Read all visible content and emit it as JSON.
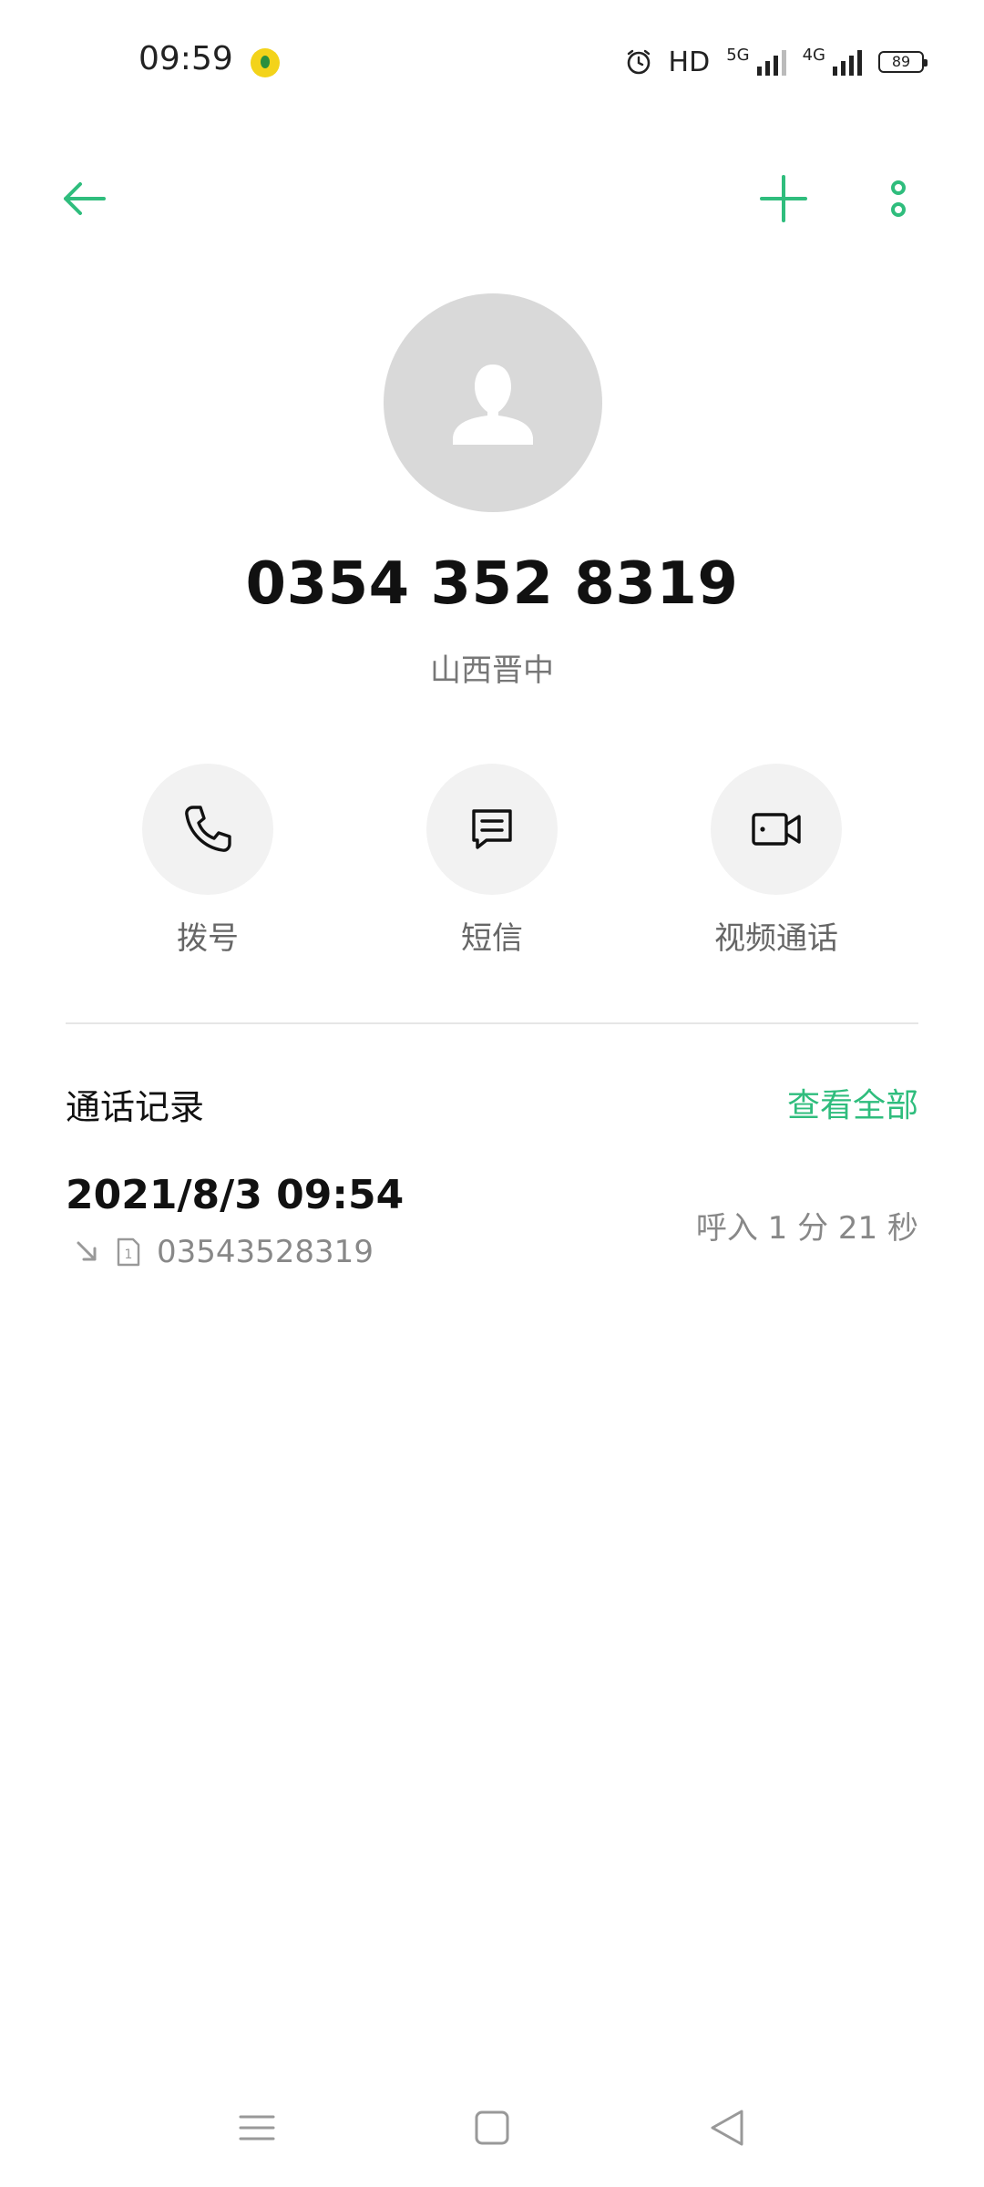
{
  "status_bar": {
    "time": "09:59",
    "hd": "HD",
    "network_5g": "5G",
    "network_4g": "4G",
    "battery": "89",
    "icons": [
      "app-notification-icon",
      "alarm-icon",
      "signal-icon",
      "battery-icon"
    ]
  },
  "toolbar": {
    "icons": [
      "back-arrow-icon",
      "add-icon",
      "more-icon"
    ],
    "accent_color": "#2fbd7d"
  },
  "contact": {
    "phone_number": "0354 352 8319",
    "location": "山西晋中"
  },
  "actions": [
    {
      "label": "拨号",
      "icon": "phone-icon"
    },
    {
      "label": "短信",
      "icon": "message-icon"
    },
    {
      "label": "视频通话",
      "icon": "video-call-icon"
    }
  ],
  "call_log": {
    "title": "通话记录",
    "view_all": "查看全部",
    "entries": [
      {
        "datetime": "2021/8/3 09:54",
        "number": "03543528319",
        "sim": "1",
        "type_duration": "呼入  1 分 21 秒",
        "direction_icon": "incoming-arrow-icon"
      }
    ]
  },
  "nav_bar": {
    "icons": [
      "menu-icon",
      "home-icon",
      "back-icon"
    ]
  }
}
